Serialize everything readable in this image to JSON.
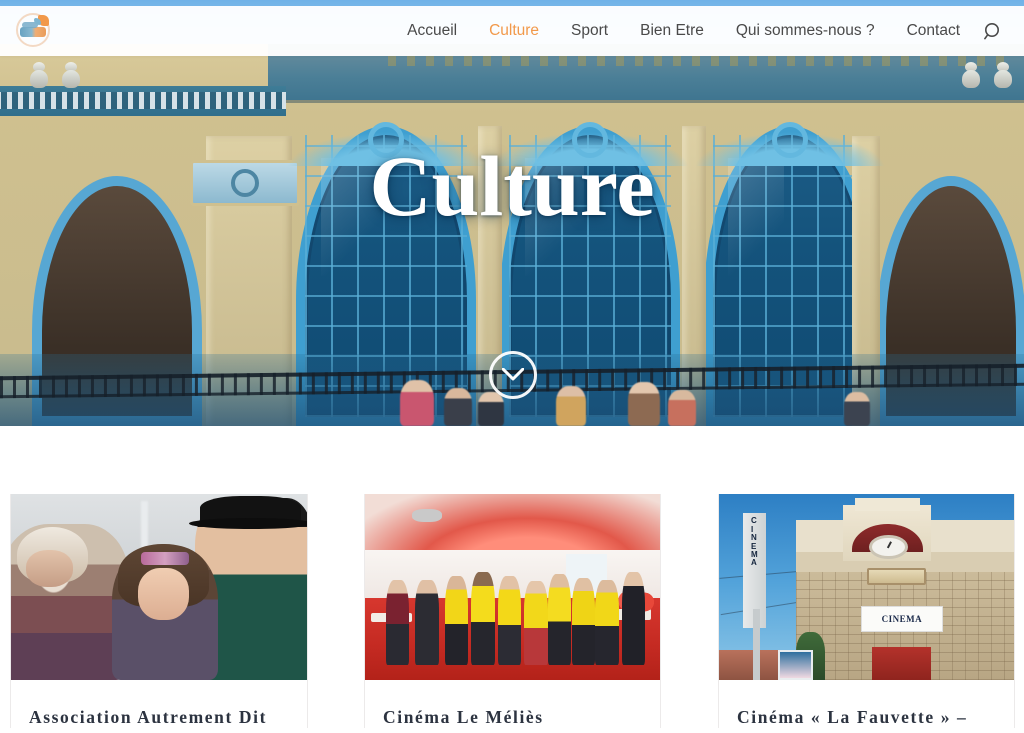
{
  "site": {
    "logo_name": "site-logo"
  },
  "nav": {
    "items": [
      {
        "label": "Accueil",
        "active": false
      },
      {
        "label": "Culture",
        "active": true
      },
      {
        "label": "Sport",
        "active": false
      },
      {
        "label": "Bien Etre",
        "active": false
      },
      {
        "label": "Qui sommes-nous ?",
        "active": false
      },
      {
        "label": "Contact",
        "active": false
      }
    ],
    "search_icon": "search-icon",
    "active_color": "#f2994a",
    "text_color": "#4a4a4a"
  },
  "hero": {
    "title": "Culture",
    "scroll_icon": "chevron-down-icon",
    "image_alt": "Historic building facade with blue arched windows"
  },
  "cards": [
    {
      "title": "Association Autrement Dit",
      "image_alt": "Three street-theatre performers in costume"
    },
    {
      "title": "Cinéma Le Méliès",
      "image_alt": "Group of people wearing yellow safety vests in a red cinema lobby"
    },
    {
      "title": "Cinéma « La Fauvette » –",
      "image_alt": "La Fauvette cinema building with vertical CINEMA sign",
      "sign_text": "CINEMA",
      "pylon_text": "CINEMA"
    }
  ]
}
